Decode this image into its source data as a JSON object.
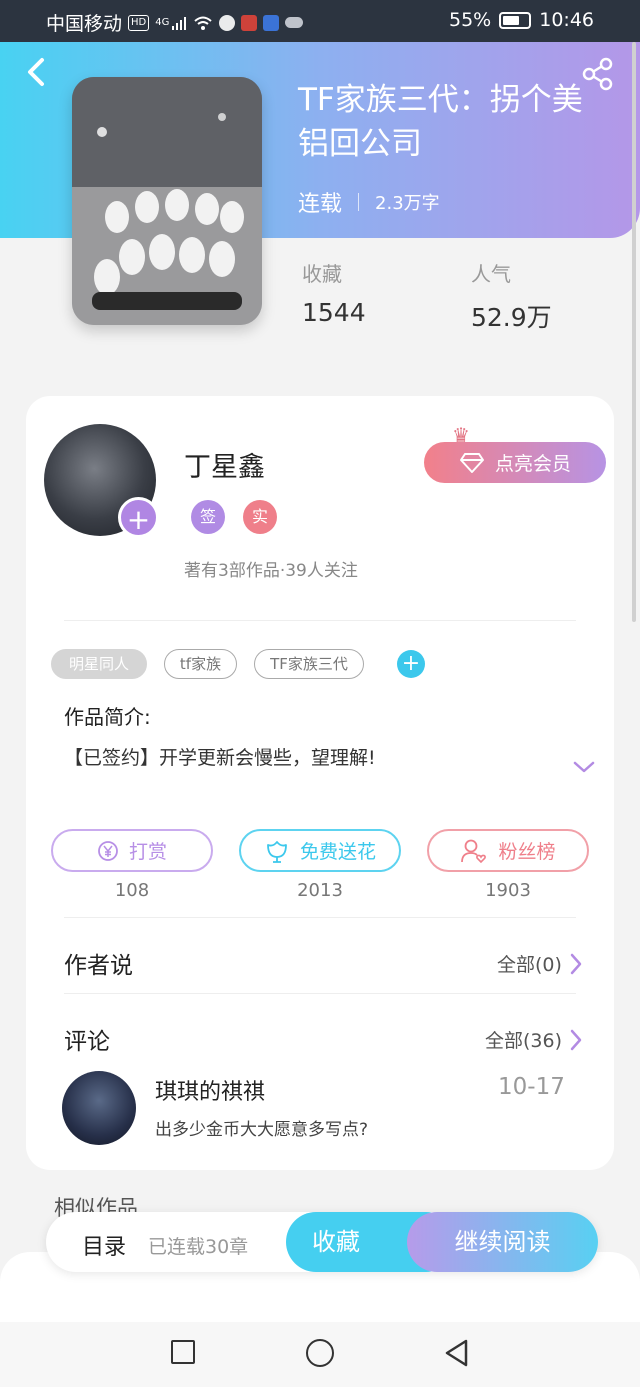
{
  "status_bar": {
    "carrier": "中国移动",
    "hd": "HD",
    "network": "4G",
    "battery": "55%",
    "time": "10:46"
  },
  "book": {
    "title": "TF家族三代：拐个美铝回公司",
    "status": "连载",
    "word_count": "2.3万字",
    "stats": [
      {
        "label": "收藏",
        "value": "1544"
      },
      {
        "label": "人气",
        "value": "52.9万"
      }
    ]
  },
  "author": {
    "name": "丁星鑫",
    "badges": [
      {
        "text": "签",
        "color": "#b08be4"
      },
      {
        "text": "实",
        "color": "#ef7f8a"
      }
    ],
    "meta": "著有3部作品·39人关注",
    "vip_button": "点亮会员"
  },
  "tags": [
    "明星同人",
    "tf家族",
    "TF家族三代"
  ],
  "intro": {
    "title": "作品简介:",
    "text": "【已签约】开学更新会慢些，望理解!"
  },
  "actions": [
    {
      "label": "打赏",
      "count": "108",
      "color": "#b78fe6"
    },
    {
      "label": "免费送花",
      "count": "2013",
      "color": "#3cc8ec"
    },
    {
      "label": "粉丝榜",
      "count": "1903",
      "color": "#ef7f8a"
    }
  ],
  "author_says": {
    "title": "作者说",
    "more": "全部(0)"
  },
  "comments": {
    "title": "评论",
    "more": "全部(36)",
    "items": [
      {
        "user": "琪琪的祺祺",
        "date": "10-17",
        "text": "出多少金币大大愿意多写点?"
      }
    ]
  },
  "similar_title": "相似作品",
  "bottom_bar": {
    "toc": "目录",
    "chapters": "已连载30章",
    "collect": "收藏",
    "continue": "继续阅读"
  }
}
